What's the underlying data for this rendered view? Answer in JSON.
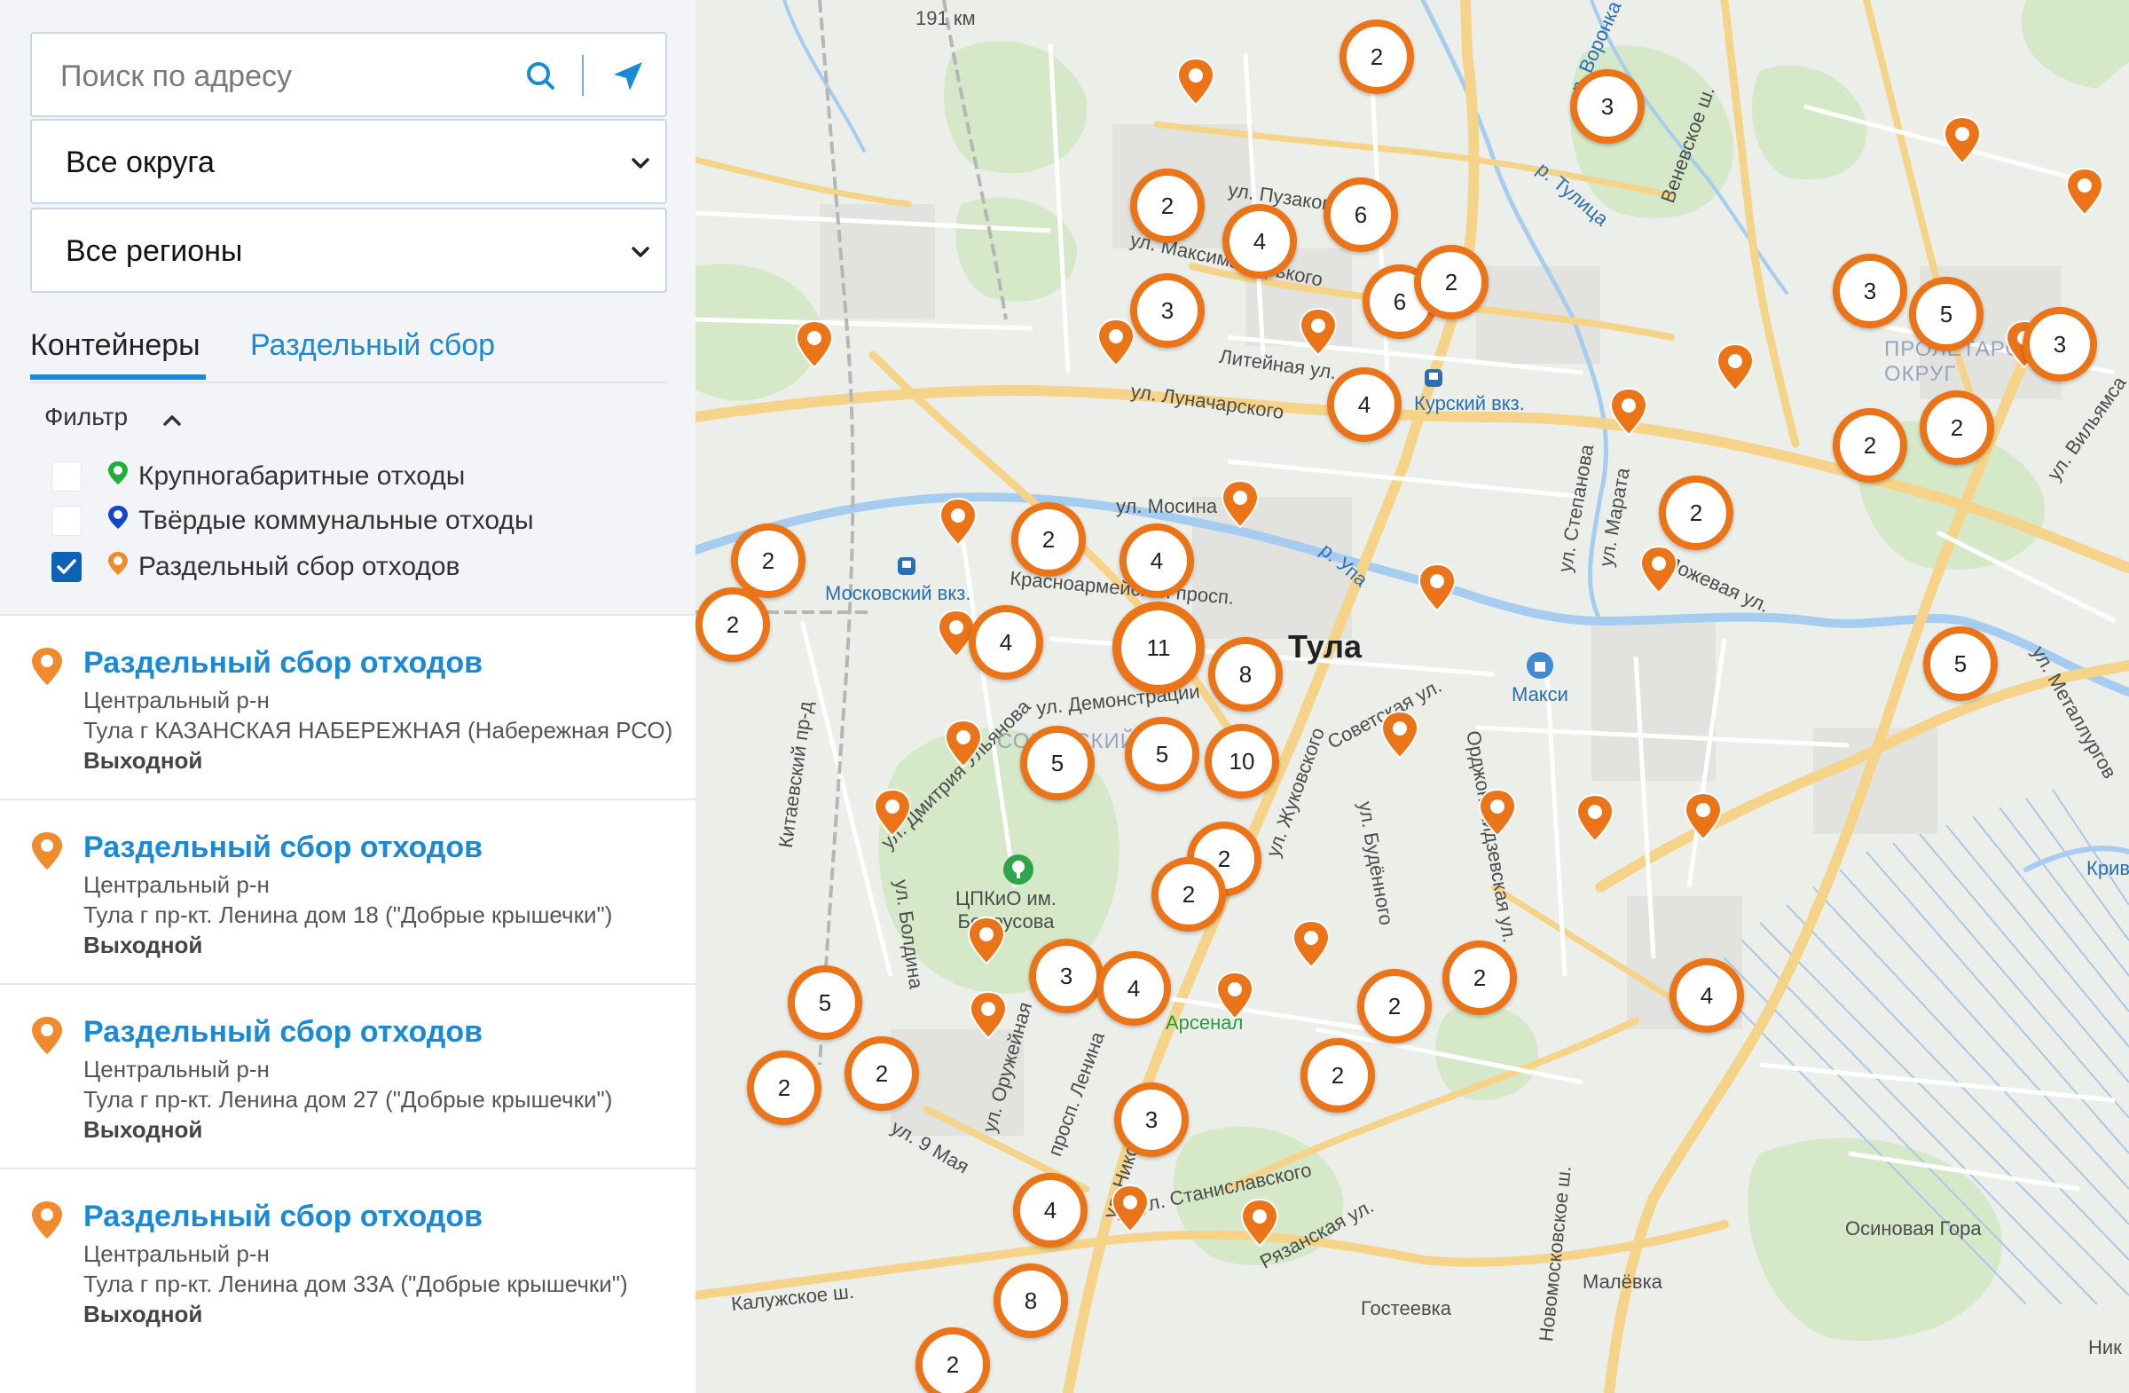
{
  "search": {
    "placeholder": "Поиск по адресу"
  },
  "district_select": {
    "value": "Все округа"
  },
  "region_select": {
    "value": "Все регионы"
  },
  "tabs": [
    {
      "label": "Контейнеры",
      "active": true
    },
    {
      "label": "Раздельный сбор",
      "active": false
    }
  ],
  "filter": {
    "title": "Фильтр",
    "items": [
      {
        "label": "Крупногабаритные отходы",
        "checked": false,
        "pin_color": "#1fae3a"
      },
      {
        "label": "Твёрдые коммунальные отходы",
        "checked": false,
        "pin_color": "#1148c9"
      },
      {
        "label": "Раздельный сбор отходов",
        "checked": true,
        "pin_color": "#f08a2c"
      }
    ]
  },
  "results": [
    {
      "title": "Раздельный сбор отходов",
      "district": "Центральный р-н",
      "address": "Тула г КАЗАНСКАЯ НАБЕРЕЖНАЯ (Набережная РСО)",
      "status": "Выходной"
    },
    {
      "title": "Раздельный сбор отходов",
      "district": "Центральный р-н",
      "address": "Тула г пр-кт. Ленина дом 18 (\"Добрые крышечки\")",
      "status": "Выходной"
    },
    {
      "title": "Раздельный сбор отходов",
      "district": "Центральный р-н",
      "address": "Тула г пр-кт. Ленина дом 27 (\"Добрые крышечки\")",
      "status": "Выходной"
    },
    {
      "title": "Раздельный сбор отходов",
      "district": "Центральный р-н",
      "address": "Тула г пр-кт. Ленина дом 33А (\"Добрые крышечки\")",
      "status": "Выходной"
    }
  ],
  "colors": {
    "accent": "#1a8ad6",
    "marker": "#ea7417",
    "checkbox": "#0e62b4"
  },
  "map": {
    "labels": [
      {
        "text": "Тула",
        "type": "city"
      },
      {
        "text": "191 км"
      },
      {
        "text": "ул. Пузакова"
      },
      {
        "text": "ул. Максима Горького"
      },
      {
        "text": "Литейная ул."
      },
      {
        "text": "ул. Луначарского"
      },
      {
        "text": "ул. Мосина"
      },
      {
        "text": "Красноармейский просп."
      },
      {
        "text": "ул. Демонстрации"
      },
      {
        "text": "Советская ул."
      },
      {
        "text": "ул. Жуковского"
      },
      {
        "text": "ул. Будённого"
      },
      {
        "text": "Орджоникидзевская ул."
      },
      {
        "text": "ул. Болдина"
      },
      {
        "text": "ул. Дмитрия Ульянова"
      },
      {
        "text": "Китаевский пр-д"
      },
      {
        "text": "ул. Оружейная"
      },
      {
        "text": "ул. 9 Мая"
      },
      {
        "text": "просп. Ленина"
      },
      {
        "text": "ул. Николаева"
      },
      {
        "text": "ул. Станиславского"
      },
      {
        "text": "Рязанская ул."
      },
      {
        "text": "Калужское ш."
      },
      {
        "text": "Новомосковское ш."
      },
      {
        "text": "Гостеевка"
      },
      {
        "text": "Малёвка"
      },
      {
        "text": "Осиновая Гора"
      },
      {
        "text": "Ложевая ул."
      },
      {
        "text": "ул. Степанова"
      },
      {
        "text": "ул. Марата"
      },
      {
        "text": "Веневское ш."
      },
      {
        "text": "ул. Вильямса"
      },
      {
        "text": "ул. Металлургов"
      },
      {
        "text": "Московский вкз.",
        "type": "blue"
      },
      {
        "text": "Курский вкз.",
        "type": "blue"
      },
      {
        "text": "Макси",
        "type": "blue"
      },
      {
        "text": "р. Упа",
        "type": "blue"
      },
      {
        "text": "р. Тулица",
        "type": "blue"
      },
      {
        "text": "р. Воронка",
        "type": "blue"
      },
      {
        "text": "Криволучье",
        "type": "blue"
      },
      {
        "text": "ЦПКиО им. Белоусова"
      },
      {
        "text": "Арсенал"
      },
      {
        "text": "ПРОЛЕТАРСКИЙ ОКРУГ",
        "type": "dist"
      },
      {
        "text": "СОВЕТСКИЙ",
        "type": "dist"
      },
      {
        "text": "Ник"
      }
    ],
    "clusters": [
      {
        "n": "2"
      },
      {
        "n": "3"
      },
      {
        "n": "2"
      },
      {
        "n": "4"
      },
      {
        "n": "6"
      },
      {
        "n": "6"
      },
      {
        "n": "2"
      },
      {
        "n": "3"
      },
      {
        "n": "4"
      },
      {
        "n": "3"
      },
      {
        "n": "5"
      },
      {
        "n": "3"
      },
      {
        "n": "2"
      },
      {
        "n": "2"
      },
      {
        "n": "2"
      },
      {
        "n": "2"
      },
      {
        "n": "2"
      },
      {
        "n": "2"
      },
      {
        "n": "4"
      },
      {
        "n": "4"
      },
      {
        "n": "11"
      },
      {
        "n": "8"
      },
      {
        "n": "5"
      },
      {
        "n": "5"
      },
      {
        "n": "10"
      },
      {
        "n": "3"
      },
      {
        "n": "5"
      },
      {
        "n": "2"
      },
      {
        "n": "2"
      },
      {
        "n": "5"
      },
      {
        "n": "3"
      },
      {
        "n": "4"
      },
      {
        "n": "2"
      },
      {
        "n": "2"
      },
      {
        "n": "4"
      },
      {
        "n": "2"
      },
      {
        "n": "2"
      },
      {
        "n": "2"
      },
      {
        "n": "3"
      },
      {
        "n": "4"
      },
      {
        "n": "8"
      },
      {
        "n": "2"
      }
    ]
  }
}
